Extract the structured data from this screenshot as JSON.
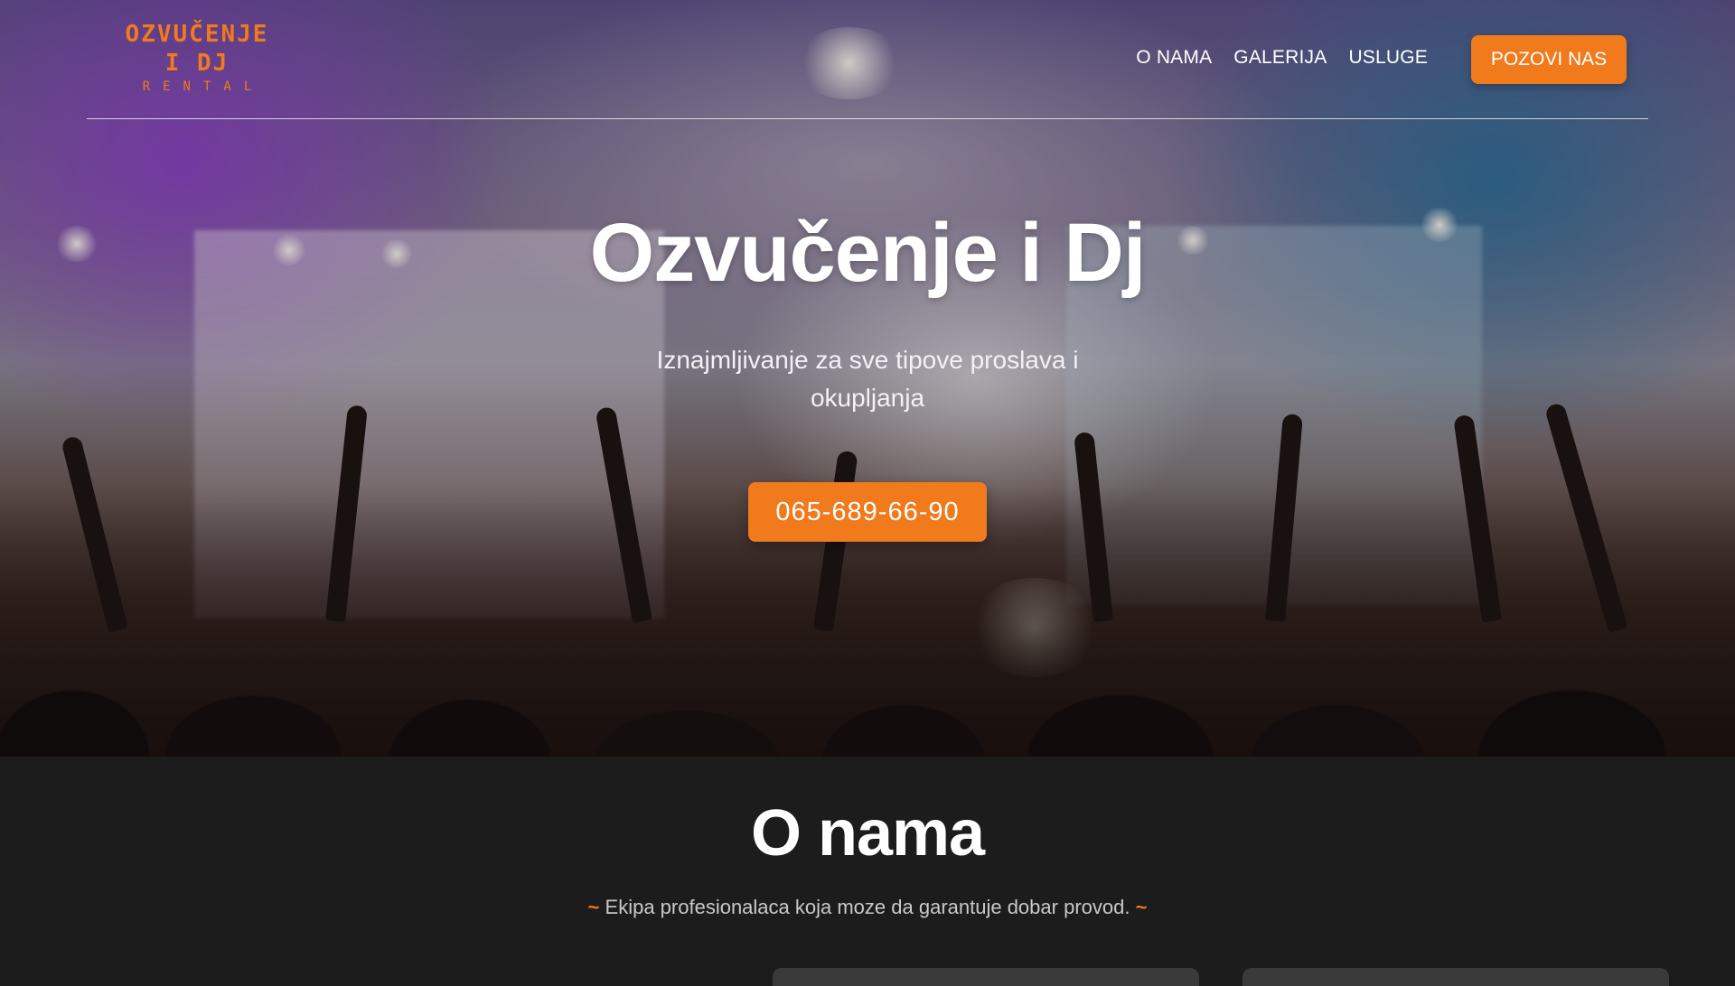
{
  "logo": {
    "line1": "OZVUČENJE",
    "line2": "I DJ",
    "sub": "RENTAL"
  },
  "nav": {
    "items": [
      {
        "label": "O NAMA"
      },
      {
        "label": "GALERIJA"
      },
      {
        "label": "USLUGE"
      }
    ],
    "cta_label": "POZOVI NAS"
  },
  "hero": {
    "title": "Ozvučenje i Dj",
    "subtitle": "Iznajmljivanje za sve tipove proslava i okupljanja",
    "phone_label": "065-689-66-90"
  },
  "about": {
    "title": "O nama",
    "tag_left": "~",
    "tagline": "Ekipa profesionalaca koja moze da garantuje dobar provod.",
    "tag_right": "~"
  },
  "colors": {
    "accent": "#f07a1c",
    "section_bg": "#1c1c1c",
    "text_light": "#ffffff"
  }
}
